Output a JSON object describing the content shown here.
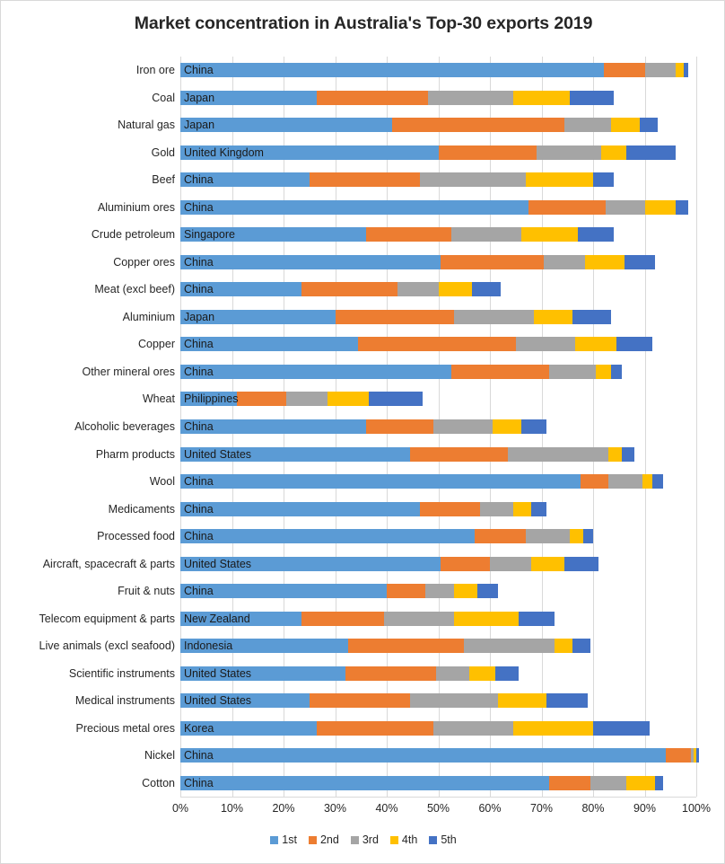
{
  "chart_data": {
    "type": "bar",
    "subtype": "stacked-horizontal-100",
    "title": "Market concentration in Australia's Top-30 exports 2019",
    "xlabel": "",
    "ylabel": "",
    "xlim": [
      0,
      100
    ],
    "xticks": [
      "0%",
      "10%",
      "20%",
      "30%",
      "40%",
      "50%",
      "60%",
      "70%",
      "80%",
      "90%",
      "100%"
    ],
    "xtick_values": [
      0,
      10,
      20,
      30,
      40,
      50,
      60,
      70,
      80,
      90,
      100
    ],
    "grid": true,
    "legend_position": "bottom",
    "legend": [
      "1st",
      "2nd",
      "3rd",
      "4th",
      "5th"
    ],
    "series": [
      {
        "name": "1st",
        "color": "#5B9BD5"
      },
      {
        "name": "2nd",
        "color": "#ED7D31"
      },
      {
        "name": "3rd",
        "color": "#A5A5A5"
      },
      {
        "name": "4th",
        "color": "#FFC000"
      },
      {
        "name": "5th",
        "color": "#4472C4"
      }
    ],
    "categories": [
      "Iron ore",
      "Coal",
      "Natural gas",
      "Gold",
      "Beef",
      "Aluminium ores",
      "Crude petroleum",
      "Copper ores",
      "Meat (excl beef)",
      "Aluminium",
      "Copper",
      "Other mineral ores",
      "Wheat",
      "Alcoholic beverages",
      "Pharm products",
      "Wool",
      "Medicaments",
      "Processed food",
      "Aircraft, spacecraft & parts",
      "Fruit & nuts",
      "Telecom equipment & parts",
      "Live animals (excl seafood)",
      "Scientific instruments",
      "Medical instruments",
      "Precious metal ores",
      "Nickel",
      "Cotton"
    ],
    "top_partner": [
      "China",
      "Japan",
      "Japan",
      "United Kingdom",
      "China",
      "China",
      "Singapore",
      "China",
      "China",
      "Japan",
      "China",
      "China",
      "Philippines",
      "China",
      "United States",
      "China",
      "China",
      "China",
      "United States",
      "China",
      "New Zealand",
      "Indonesia",
      "United States",
      "United States",
      "Korea",
      "China",
      "China"
    ],
    "rows": [
      {
        "category": "Iron ore",
        "partner": "China",
        "values": [
          82.0,
          8.0,
          6.0,
          1.5,
          1.0
        ],
        "total": 98.5
      },
      {
        "category": "Coal",
        "partner": "Japan",
        "values": [
          26.5,
          21.5,
          16.5,
          11.0,
          8.5
        ],
        "total": 84.0
      },
      {
        "category": "Natural gas",
        "partner": "Japan",
        "values": [
          41.0,
          33.5,
          9.0,
          5.5,
          3.5
        ],
        "total": 92.5
      },
      {
        "category": "Gold",
        "partner": "United Kingdom",
        "values": [
          50.0,
          19.0,
          12.5,
          5.0,
          9.5
        ],
        "total": 96.0
      },
      {
        "category": "Beef",
        "partner": "China",
        "values": [
          25.0,
          21.5,
          20.5,
          13.0,
          4.0
        ],
        "total": 84.0
      },
      {
        "category": "Aluminium ores",
        "partner": "China",
        "values": [
          67.5,
          15.0,
          7.5,
          6.0,
          2.5
        ],
        "total": 98.5
      },
      {
        "category": "Crude petroleum",
        "partner": "Singapore",
        "values": [
          36.0,
          16.5,
          13.5,
          11.0,
          7.0
        ],
        "total": 84.0
      },
      {
        "category": "Copper ores",
        "partner": "China",
        "values": [
          50.5,
          20.0,
          8.0,
          7.5,
          6.0
        ],
        "total": 92.0
      },
      {
        "category": "Meat (excl beef)",
        "partner": "China",
        "values": [
          23.5,
          18.5,
          8.0,
          6.5,
          5.5
        ],
        "total": 62.0
      },
      {
        "category": "Aluminium",
        "partner": "Japan",
        "values": [
          30.0,
          23.0,
          15.5,
          7.5,
          7.5
        ],
        "total": 83.5
      },
      {
        "category": "Copper",
        "partner": "China",
        "values": [
          34.5,
          30.5,
          11.5,
          8.0,
          7.0
        ],
        "total": 91.5
      },
      {
        "category": "Other mineral ores",
        "partner": "China",
        "values": [
          52.5,
          19.0,
          9.0,
          3.0,
          2.0
        ],
        "total": 85.5
      },
      {
        "category": "Wheat",
        "partner": "Philippines",
        "values": [
          11.0,
          9.5,
          8.0,
          8.0,
          10.5
        ],
        "total": 57.0
      },
      {
        "category": "Alcoholic beverages",
        "partner": "China",
        "values": [
          36.0,
          13.0,
          11.5,
          5.5,
          5.0
        ],
        "total": 71.0
      },
      {
        "category": "Pharm products",
        "partner": "United States",
        "values": [
          44.5,
          19.0,
          19.5,
          2.5,
          2.5
        ],
        "total": 88.0
      },
      {
        "category": "Wool",
        "partner": "China",
        "values": [
          77.5,
          5.5,
          6.5,
          2.0,
          2.0
        ],
        "total": 93.5
      },
      {
        "category": "Medicaments",
        "partner": "China",
        "values": [
          46.5,
          11.5,
          6.5,
          3.5,
          3.0
        ],
        "total": 71.0
      },
      {
        "category": "Processed food",
        "partner": "China",
        "values": [
          57.0,
          10.0,
          8.5,
          2.5,
          2.0
        ],
        "total": 80.0
      },
      {
        "category": "Aircraft, spacecraft & parts",
        "partner": "United States",
        "values": [
          50.5,
          9.5,
          8.0,
          6.5,
          6.5
        ],
        "total": 81.0
      },
      {
        "category": "Fruit & nuts",
        "partner": "China",
        "values": [
          40.0,
          7.5,
          5.5,
          4.5,
          4.0
        ],
        "total": 61.5
      },
      {
        "category": "Telecom equipment & parts",
        "partner": "New Zealand",
        "values": [
          23.5,
          16.0,
          13.5,
          12.5,
          7.0
        ],
        "total": 72.5
      },
      {
        "category": "Live animals (excl seafood)",
        "partner": "Indonesia",
        "values": [
          32.5,
          22.5,
          17.5,
          3.5,
          3.5
        ],
        "total": 79.5
      },
      {
        "category": "Scientific instruments",
        "partner": "United States",
        "values": [
          32.0,
          17.5,
          6.5,
          5.0,
          4.5
        ],
        "total": 65.5
      },
      {
        "category": "Medical instruments",
        "partner": "United States",
        "values": [
          25.0,
          19.5,
          17.0,
          9.5,
          8.0
        ],
        "total": 79.0
      },
      {
        "category": "Precious metal ores",
        "partner": "Korea",
        "values": [
          26.5,
          22.5,
          15.5,
          15.5,
          11.0
        ],
        "total": 91.0
      },
      {
        "category": "Nickel",
        "partner": "China",
        "values": [
          94.0,
          5.0,
          0.4,
          0.6,
          0.5
        ],
        "total": 100.5
      },
      {
        "category": "Cotton",
        "partner": "China",
        "values": [
          71.5,
          8.0,
          7.0,
          5.5,
          1.5
        ],
        "total": 93.5
      }
    ]
  }
}
